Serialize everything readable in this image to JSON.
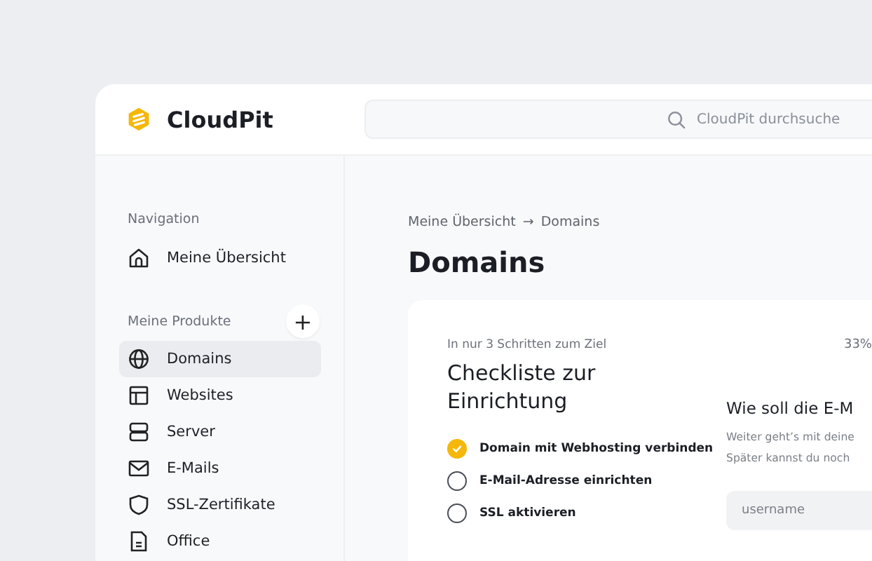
{
  "brand": {
    "name": "CloudPit"
  },
  "search": {
    "placeholder": "CloudPit durchsuche"
  },
  "sidebar": {
    "navigation_heading": "Navigation",
    "navigation_items": [
      {
        "label": "Meine Übersicht",
        "selected": false
      }
    ],
    "products_heading": "Meine Produkte",
    "add_button": "+",
    "product_items": [
      {
        "label": "Domains",
        "selected": true
      },
      {
        "label": "Websites",
        "selected": false
      },
      {
        "label": "Server",
        "selected": false
      },
      {
        "label": "E-Mails",
        "selected": false
      },
      {
        "label": "SSL-Zertifikate",
        "selected": false
      },
      {
        "label": "Office",
        "selected": false
      }
    ]
  },
  "breadcrumb": {
    "items": [
      "Meine Übersicht",
      "Domains"
    ],
    "separator": "→"
  },
  "page_title": "Domains",
  "checklist": {
    "eyebrow": "In nur 3 Schritten zum Ziel",
    "title": "Checkliste zur Einrichtung",
    "progress": "33%",
    "items": [
      {
        "label": "Domain mit Webhosting verbinden",
        "checked": true
      },
      {
        "label": "E-Mail-Adresse einrichten",
        "checked": false
      },
      {
        "label": "SSL aktivieren",
        "checked": false
      }
    ]
  },
  "email_setup": {
    "title": "Wie soll die E-M",
    "text_lines": [
      "Weiter geht’s mit deine",
      "Später kannst du noch"
    ],
    "username": {
      "placeholder": "username"
    }
  }
}
